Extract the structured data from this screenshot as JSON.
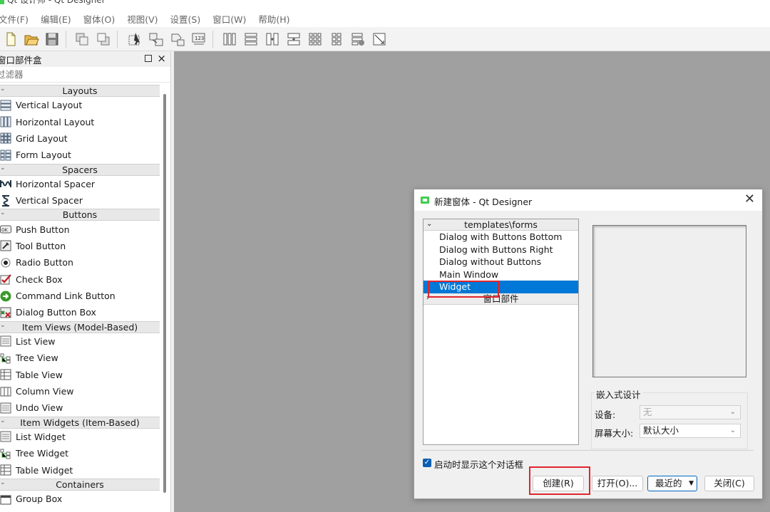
{
  "window": {
    "title": "Qt 设计师 - Qt Designer"
  },
  "menubar": [
    "文件(F)",
    "编辑(E)",
    "窗体(O)",
    "视图(V)",
    "设置(S)",
    "窗口(W)",
    "帮助(H)"
  ],
  "toolbar": {
    "icons": [
      "new-file-icon",
      "open-folder-icon",
      "save-icon",
      "send-to-back-icon",
      "bring-to-front-icon",
      "edit-widgets-icon",
      "edit-signals-slots-icon",
      "edit-buddies-icon",
      "edit-tab-order-icon",
      "layout-horizontal-icon",
      "layout-vertical-icon",
      "layout-horizontal-splitter-icon",
      "layout-vertical-splitter-icon",
      "layout-grid-icon",
      "layout-form-icon",
      "break-layout-icon",
      "adjust-size-icon"
    ]
  },
  "widget_box": {
    "title": "窗口部件盒",
    "filter_placeholder": "过滤器",
    "sections": [
      {
        "label": "Layouts",
        "items": [
          "Vertical Layout",
          "Horizontal Layout",
          "Grid Layout",
          "Form Layout"
        ]
      },
      {
        "label": "Spacers",
        "items": [
          "Horizontal Spacer",
          "Vertical Spacer"
        ]
      },
      {
        "label": "Buttons",
        "items": [
          "Push Button",
          "Tool Button",
          "Radio Button",
          "Check Box",
          "Command Link Button",
          "Dialog Button Box"
        ]
      },
      {
        "label": "Item Views (Model-Based)",
        "items": [
          "List View",
          "Tree View",
          "Table View",
          "Column View",
          "Undo View"
        ]
      },
      {
        "label": "Item Widgets (Item-Based)",
        "items": [
          "List Widget",
          "Tree Widget",
          "Table Widget"
        ]
      },
      {
        "label": "Containers",
        "items": [
          "Group Box"
        ]
      }
    ]
  },
  "dialog": {
    "title": "新建窗体 - Qt Designer",
    "tree_header": "templates\\forms",
    "templates": [
      "Dialog with Buttons Bottom",
      "Dialog with Buttons Right",
      "Dialog without Buttons",
      "Main Window",
      "Widget"
    ],
    "selected_template": "Widget",
    "second_group": "窗口部件",
    "embedded_design": {
      "group_title": "嵌入式设计",
      "device_label": "设备:",
      "device_value": "无",
      "screen_label": "屏幕大小:",
      "screen_value": "默认大小"
    },
    "show_on_startup": {
      "label": "启动时显示这个对话框",
      "checked": true
    },
    "buttons": {
      "create": "创建(R)",
      "open": "打开(O)...",
      "recent": "最近的",
      "close": "关闭(C)"
    }
  },
  "colors": {
    "accent": "#0078d7",
    "highlight_box": "#e0262c",
    "mdi_background": "#a0a0a0"
  }
}
